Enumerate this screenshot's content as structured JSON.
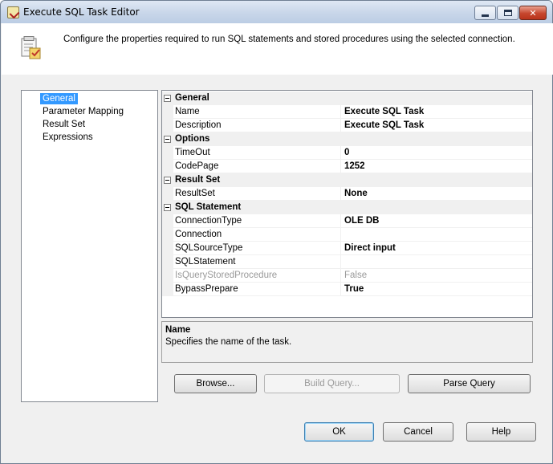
{
  "window": {
    "title": "Execute SQL Task Editor"
  },
  "header": {
    "description": "Configure the properties required to run SQL statements and stored procedures using the selected connection."
  },
  "nav": {
    "items": [
      {
        "label": "General",
        "selected": true
      },
      {
        "label": "Parameter Mapping",
        "selected": false
      },
      {
        "label": "Result Set",
        "selected": false
      },
      {
        "label": "Expressions",
        "selected": false
      }
    ]
  },
  "grid": {
    "general": {
      "category": "General",
      "name_label": "Name",
      "name_value": "Execute SQL Task",
      "description_label": "Description",
      "description_value": "Execute SQL Task"
    },
    "options": {
      "category": "Options",
      "timeout_label": "TimeOut",
      "timeout_value": "0",
      "codepage_label": "CodePage",
      "codepage_value": "1252"
    },
    "result_set": {
      "category": "Result Set",
      "resultset_label": "ResultSet",
      "resultset_value": "None"
    },
    "sql_statement": {
      "category": "SQL Statement",
      "connectiontype_label": "ConnectionType",
      "connectiontype_value": "OLE DB",
      "connection_label": "Connection",
      "connection_value": "",
      "sqlsourcetype_label": "SQLSourceType",
      "sqlsourcetype_value": "Direct input",
      "sqlstatement_label": "SQLStatement",
      "sqlstatement_value": "",
      "isquerystoredprocedure_label": "IsQueryStoredProcedure",
      "isquerystoredprocedure_value": "False",
      "bypassprepare_label": "BypassPrepare",
      "bypassprepare_value": "True"
    }
  },
  "description_panel": {
    "title": "Name",
    "body": "Specifies the name of the task."
  },
  "buttons": {
    "browse": "Browse...",
    "build_query": "Build Query...",
    "parse_query": "Parse Query",
    "ok": "OK",
    "cancel": "Cancel",
    "help": "Help"
  }
}
